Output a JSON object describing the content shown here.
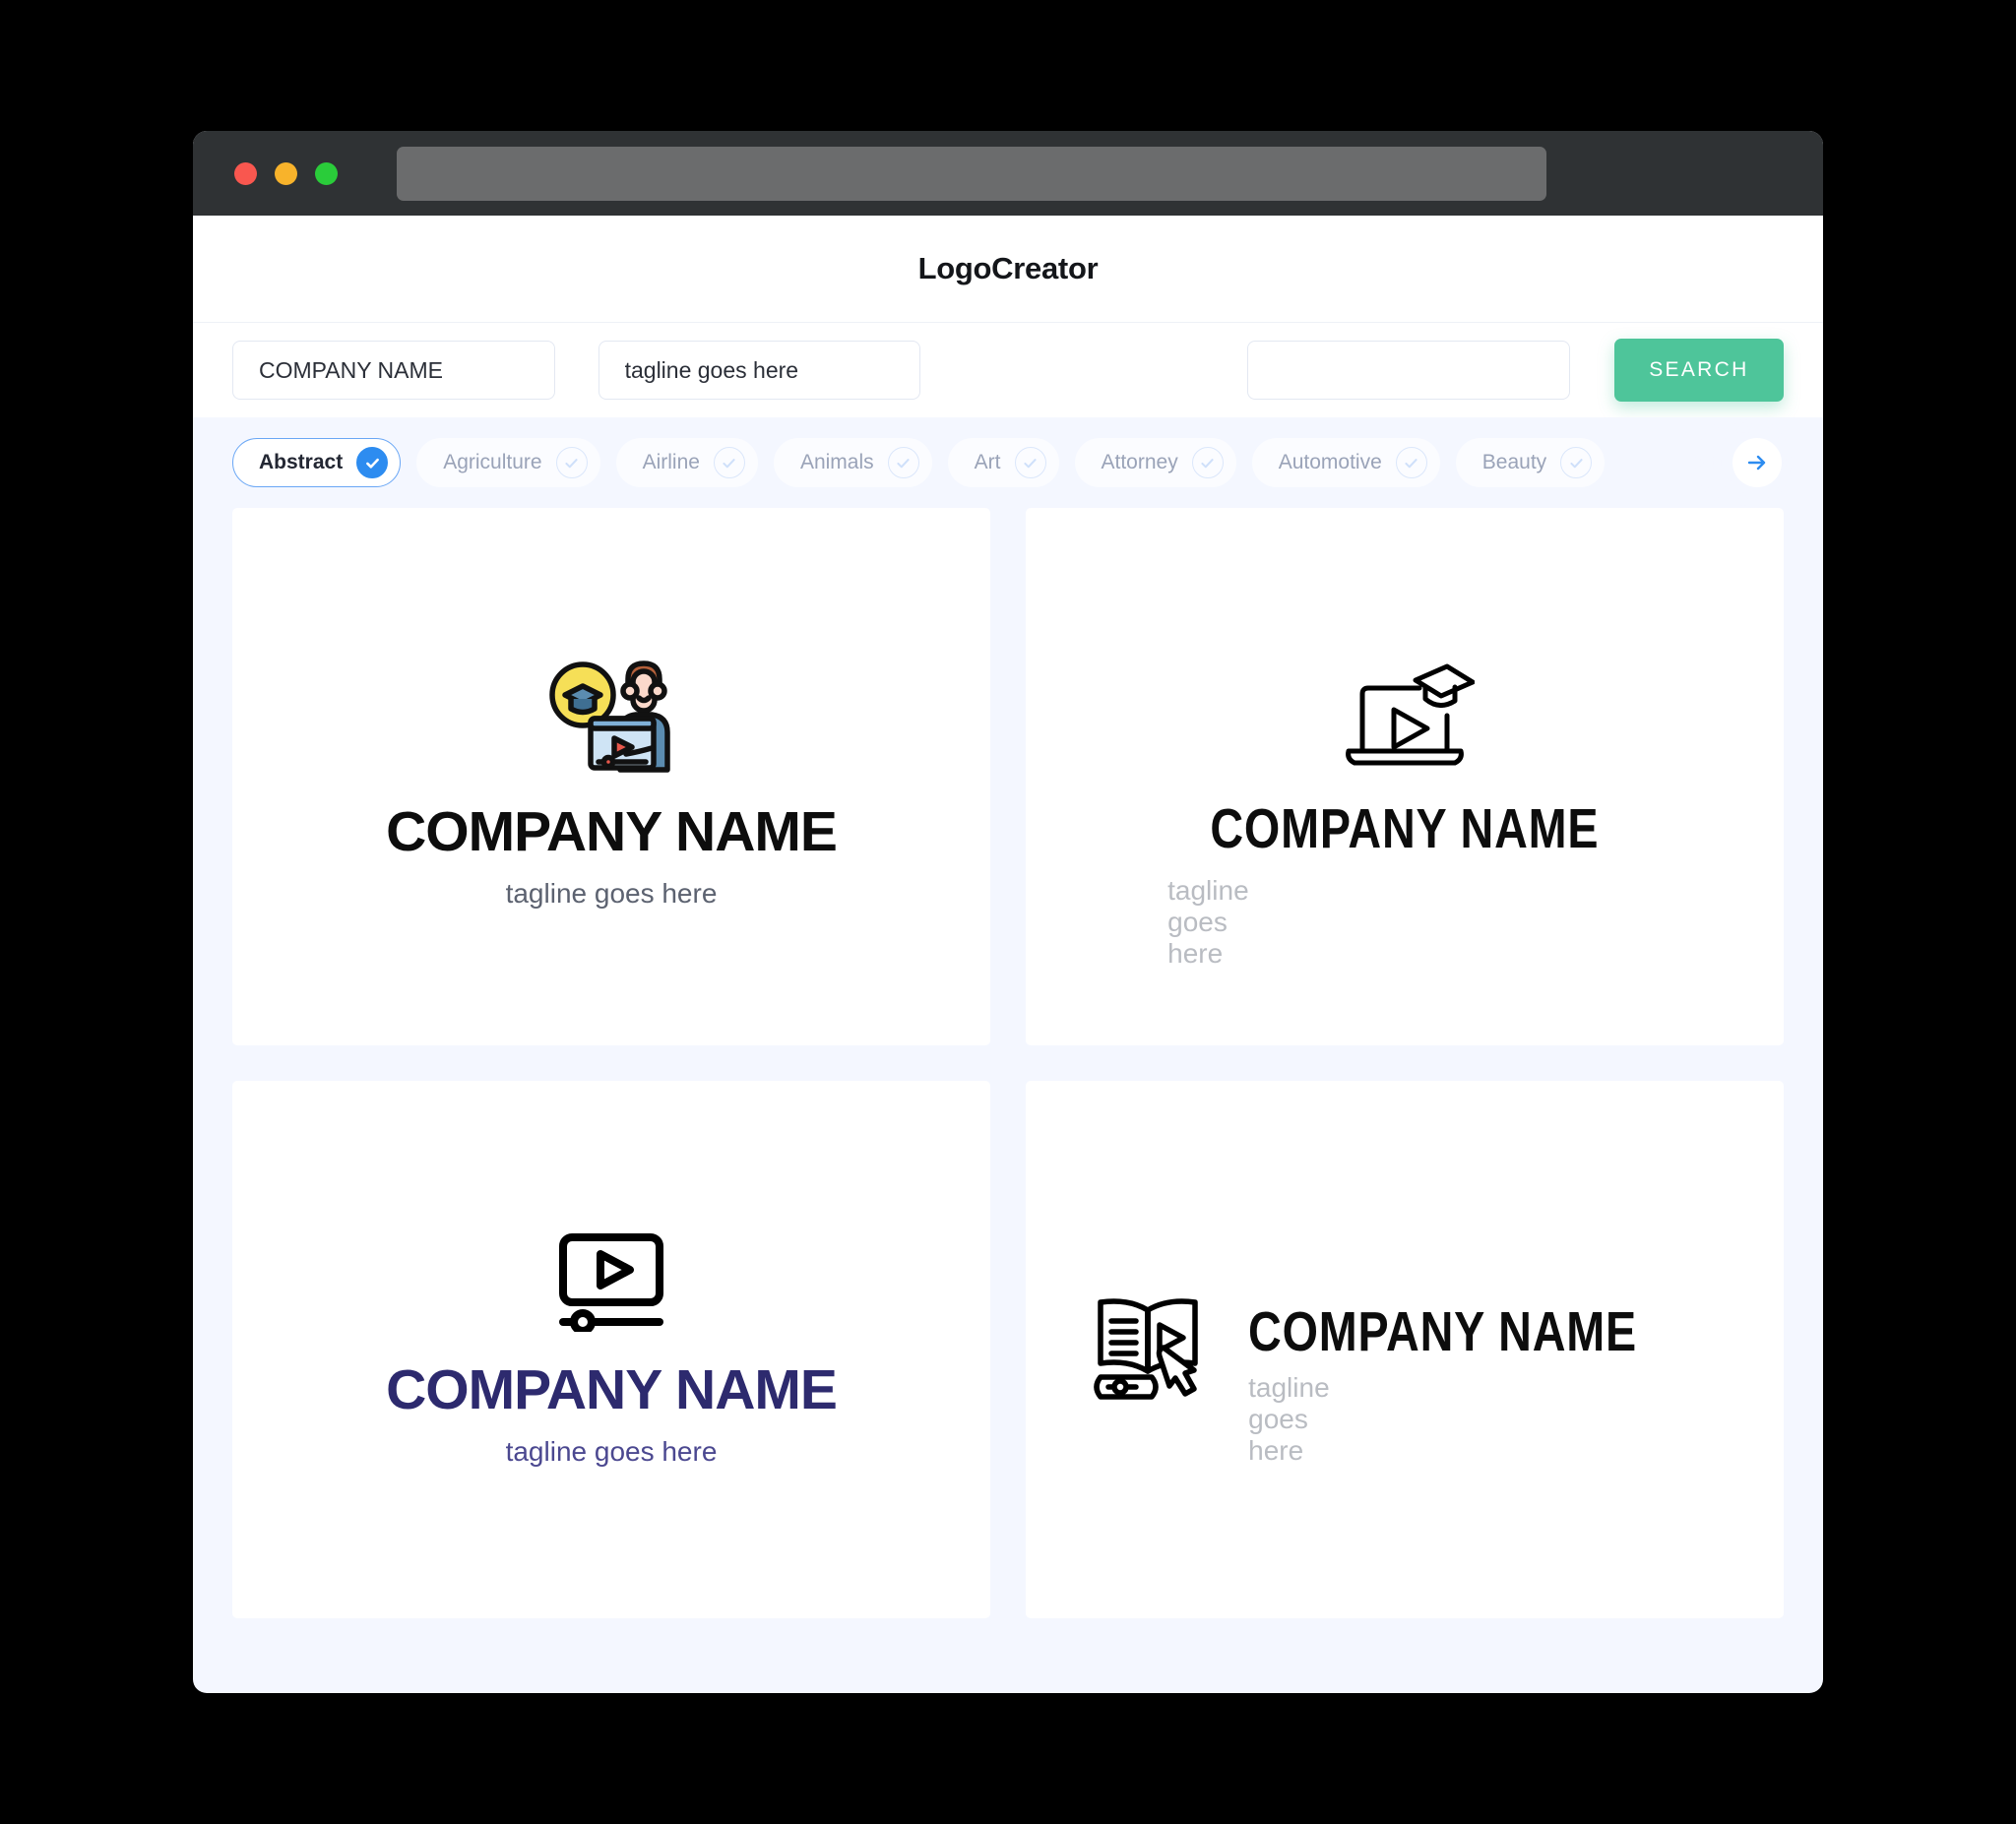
{
  "window": {
    "traffic_lights": [
      "close",
      "minimize",
      "maximize"
    ],
    "url_value": ""
  },
  "header": {
    "title": "LogoCreator"
  },
  "search": {
    "company_name_value": "COMPANY NAME",
    "tagline_value": "tagline goes here",
    "extra_value": "",
    "extra_placeholder": "",
    "search_button": "SEARCH"
  },
  "categories": {
    "items": [
      {
        "label": "Abstract",
        "selected": true
      },
      {
        "label": "Agriculture",
        "selected": false
      },
      {
        "label": "Airline",
        "selected": false
      },
      {
        "label": "Animals",
        "selected": false
      },
      {
        "label": "Art",
        "selected": false
      },
      {
        "label": "Attorney",
        "selected": false
      },
      {
        "label": "Automotive",
        "selected": false
      },
      {
        "label": "Beauty",
        "selected": false
      }
    ],
    "next_icon": "arrow-right-icon"
  },
  "results": {
    "cards": [
      {
        "art": "person-graduation-video-illustration",
        "name": "COMPANY NAME",
        "tagline": "tagline goes here",
        "layout": "stacked",
        "name_color": "#0d0d0d",
        "tagline_color": "#5c6270"
      },
      {
        "art": "laptop-play-graduation-cap-icon",
        "name": "COMPANY NAME",
        "tagline": "tagline goes here",
        "layout": "stacked",
        "name_color": "#0d0d0d",
        "tagline_color": "#b9bcc2"
      },
      {
        "art": "video-player-progress-icon",
        "name": "COMPANY NAME",
        "tagline": "tagline goes here",
        "layout": "stacked",
        "name_color": "#2d2a6e",
        "tagline_color": "#4b4890"
      },
      {
        "art": "open-book-play-cursor-icon",
        "name": "COMPANY NAME",
        "tagline": "tagline goes here",
        "layout": "horizontal",
        "name_color": "#0d0d0d",
        "tagline_color": "#b9bcc2"
      }
    ]
  },
  "colors": {
    "accent_green": "#4ec59a",
    "accent_blue": "#2d8cf0",
    "page_background": "#f4f7ff",
    "chrome": "#2f3234"
  }
}
